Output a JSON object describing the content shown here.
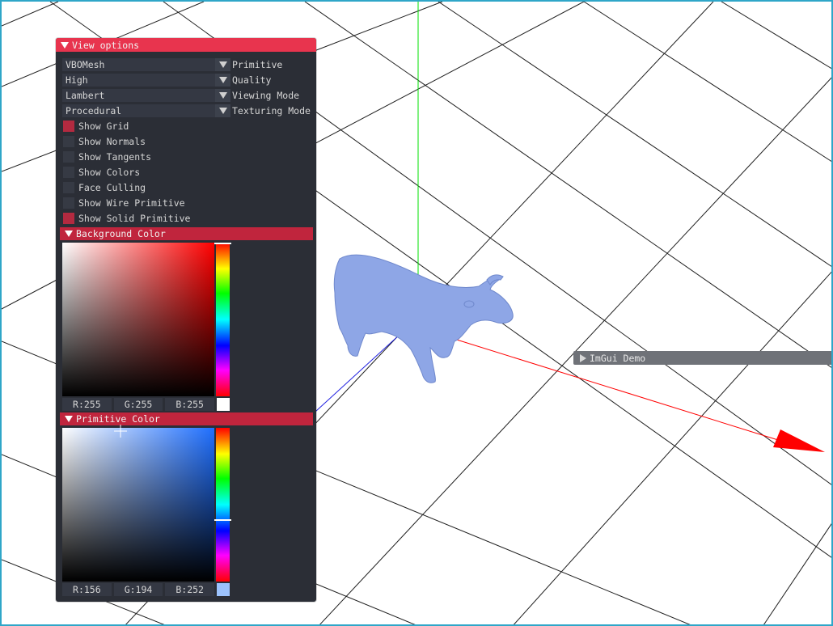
{
  "view_options": {
    "title": "View options",
    "combos": [
      {
        "value": "VBOMesh",
        "label": "Primitive"
      },
      {
        "value": "High",
        "label": "Quality"
      },
      {
        "value": "Lambert",
        "label": "Viewing Mode"
      },
      {
        "value": "Procedural",
        "label": "Texturing Mode"
      }
    ],
    "checkboxes": [
      {
        "label": "Show Grid",
        "checked": true
      },
      {
        "label": "Show Normals",
        "checked": false
      },
      {
        "label": "Show Tangents",
        "checked": false
      },
      {
        "label": "Show Colors",
        "checked": false
      },
      {
        "label": "Face Culling",
        "checked": false
      },
      {
        "label": "Show Wire Primitive",
        "checked": false
      },
      {
        "label": "Show Solid Primitive",
        "checked": true
      }
    ],
    "background_color": {
      "title": "Background Color",
      "r": "R:255",
      "g": "G:255",
      "b": "B:255",
      "hue_color": "#ff0000",
      "swatch": "#ffffff",
      "hue_level": 0.0
    },
    "primitive_color": {
      "title": "Primitive Color",
      "r": "R:156",
      "g": "G:194",
      "b": "B:252",
      "hue_color": "#1f6fff",
      "swatch": "#9cc2fc",
      "hue_level": 0.6
    }
  },
  "imgui_demo": {
    "title": "ImGui Demo"
  },
  "colors": {
    "accent_title": "#e8344e",
    "header": "#c0253d",
    "panel_bg": "#2b2e36",
    "model": "#8ea6e6",
    "viewport_border": "#2fa6c8"
  }
}
